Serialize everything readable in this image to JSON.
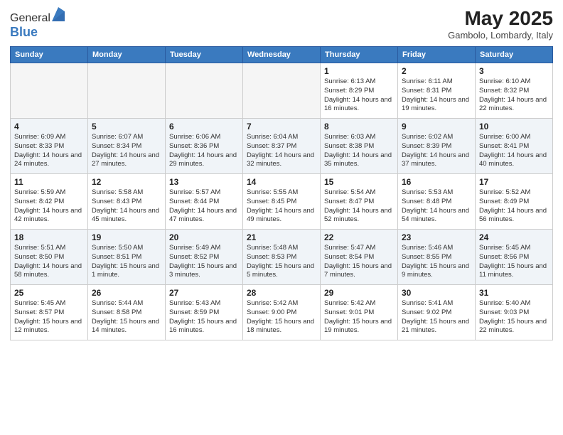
{
  "logo": {
    "general": "General",
    "blue": "Blue"
  },
  "title": "May 2025",
  "subtitle": "Gambolo, Lombardy, Italy",
  "days_of_week": [
    "Sunday",
    "Monday",
    "Tuesday",
    "Wednesday",
    "Thursday",
    "Friday",
    "Saturday"
  ],
  "weeks": [
    [
      {
        "day": "",
        "info": ""
      },
      {
        "day": "",
        "info": ""
      },
      {
        "day": "",
        "info": ""
      },
      {
        "day": "",
        "info": ""
      },
      {
        "day": "1",
        "info": "Sunrise: 6:13 AM\nSunset: 8:29 PM\nDaylight: 14 hours and 16 minutes."
      },
      {
        "day": "2",
        "info": "Sunrise: 6:11 AM\nSunset: 8:31 PM\nDaylight: 14 hours and 19 minutes."
      },
      {
        "day": "3",
        "info": "Sunrise: 6:10 AM\nSunset: 8:32 PM\nDaylight: 14 hours and 22 minutes."
      }
    ],
    [
      {
        "day": "4",
        "info": "Sunrise: 6:09 AM\nSunset: 8:33 PM\nDaylight: 14 hours and 24 minutes."
      },
      {
        "day": "5",
        "info": "Sunrise: 6:07 AM\nSunset: 8:34 PM\nDaylight: 14 hours and 27 minutes."
      },
      {
        "day": "6",
        "info": "Sunrise: 6:06 AM\nSunset: 8:36 PM\nDaylight: 14 hours and 29 minutes."
      },
      {
        "day": "7",
        "info": "Sunrise: 6:04 AM\nSunset: 8:37 PM\nDaylight: 14 hours and 32 minutes."
      },
      {
        "day": "8",
        "info": "Sunrise: 6:03 AM\nSunset: 8:38 PM\nDaylight: 14 hours and 35 minutes."
      },
      {
        "day": "9",
        "info": "Sunrise: 6:02 AM\nSunset: 8:39 PM\nDaylight: 14 hours and 37 minutes."
      },
      {
        "day": "10",
        "info": "Sunrise: 6:00 AM\nSunset: 8:41 PM\nDaylight: 14 hours and 40 minutes."
      }
    ],
    [
      {
        "day": "11",
        "info": "Sunrise: 5:59 AM\nSunset: 8:42 PM\nDaylight: 14 hours and 42 minutes."
      },
      {
        "day": "12",
        "info": "Sunrise: 5:58 AM\nSunset: 8:43 PM\nDaylight: 14 hours and 45 minutes."
      },
      {
        "day": "13",
        "info": "Sunrise: 5:57 AM\nSunset: 8:44 PM\nDaylight: 14 hours and 47 minutes."
      },
      {
        "day": "14",
        "info": "Sunrise: 5:55 AM\nSunset: 8:45 PM\nDaylight: 14 hours and 49 minutes."
      },
      {
        "day": "15",
        "info": "Sunrise: 5:54 AM\nSunset: 8:47 PM\nDaylight: 14 hours and 52 minutes."
      },
      {
        "day": "16",
        "info": "Sunrise: 5:53 AM\nSunset: 8:48 PM\nDaylight: 14 hours and 54 minutes."
      },
      {
        "day": "17",
        "info": "Sunrise: 5:52 AM\nSunset: 8:49 PM\nDaylight: 14 hours and 56 minutes."
      }
    ],
    [
      {
        "day": "18",
        "info": "Sunrise: 5:51 AM\nSunset: 8:50 PM\nDaylight: 14 hours and 58 minutes."
      },
      {
        "day": "19",
        "info": "Sunrise: 5:50 AM\nSunset: 8:51 PM\nDaylight: 15 hours and 1 minute."
      },
      {
        "day": "20",
        "info": "Sunrise: 5:49 AM\nSunset: 8:52 PM\nDaylight: 15 hours and 3 minutes."
      },
      {
        "day": "21",
        "info": "Sunrise: 5:48 AM\nSunset: 8:53 PM\nDaylight: 15 hours and 5 minutes."
      },
      {
        "day": "22",
        "info": "Sunrise: 5:47 AM\nSunset: 8:54 PM\nDaylight: 15 hours and 7 minutes."
      },
      {
        "day": "23",
        "info": "Sunrise: 5:46 AM\nSunset: 8:55 PM\nDaylight: 15 hours and 9 minutes."
      },
      {
        "day": "24",
        "info": "Sunrise: 5:45 AM\nSunset: 8:56 PM\nDaylight: 15 hours and 11 minutes."
      }
    ],
    [
      {
        "day": "25",
        "info": "Sunrise: 5:45 AM\nSunset: 8:57 PM\nDaylight: 15 hours and 12 minutes."
      },
      {
        "day": "26",
        "info": "Sunrise: 5:44 AM\nSunset: 8:58 PM\nDaylight: 15 hours and 14 minutes."
      },
      {
        "day": "27",
        "info": "Sunrise: 5:43 AM\nSunset: 8:59 PM\nDaylight: 15 hours and 16 minutes."
      },
      {
        "day": "28",
        "info": "Sunrise: 5:42 AM\nSunset: 9:00 PM\nDaylight: 15 hours and 18 minutes."
      },
      {
        "day": "29",
        "info": "Sunrise: 5:42 AM\nSunset: 9:01 PM\nDaylight: 15 hours and 19 minutes."
      },
      {
        "day": "30",
        "info": "Sunrise: 5:41 AM\nSunset: 9:02 PM\nDaylight: 15 hours and 21 minutes."
      },
      {
        "day": "31",
        "info": "Sunrise: 5:40 AM\nSunset: 9:03 PM\nDaylight: 15 hours and 22 minutes."
      }
    ]
  ]
}
